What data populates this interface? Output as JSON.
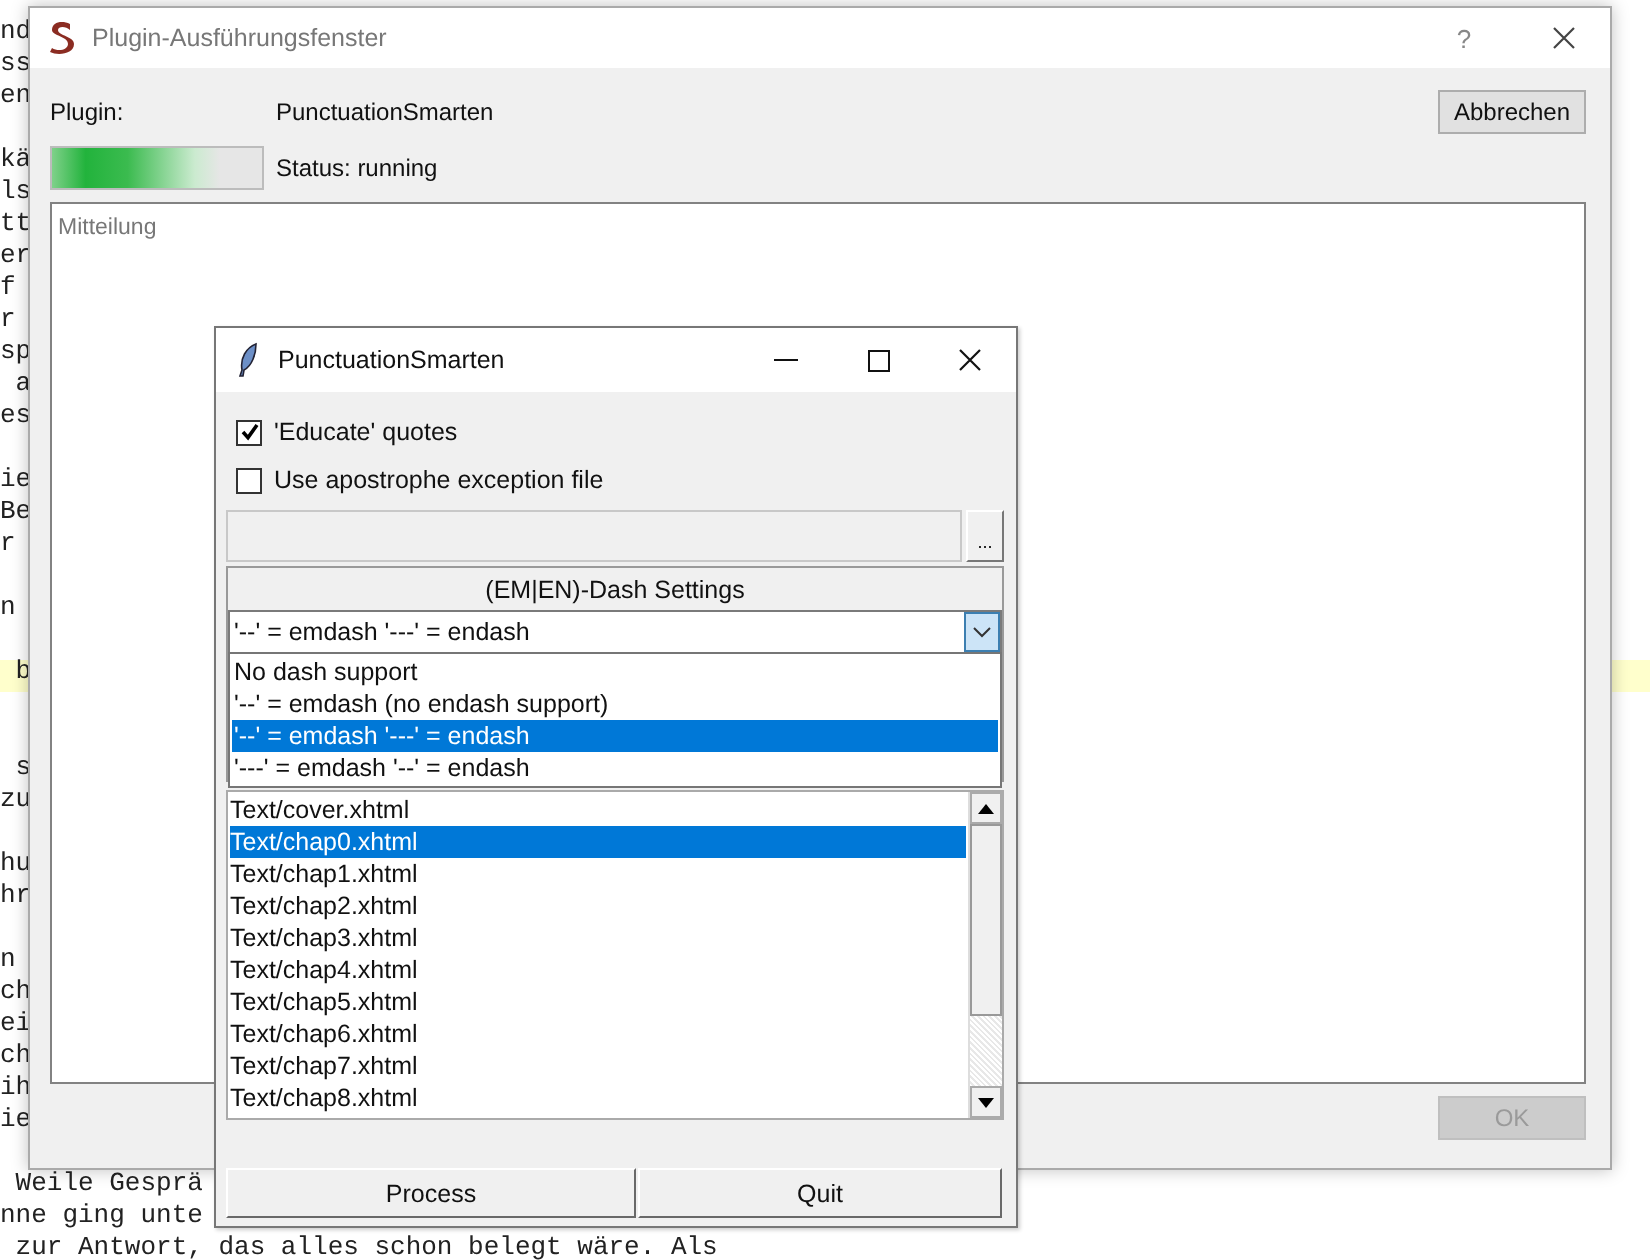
{
  "editor": {
    "blocks": [
      {
        "lines": [
          "nd",
          "ss",
          "en"
        ],
        "highlighted": false
      },
      {
        "lines": [
          "kä",
          "ls",
          "tt",
          "er",
          "f",
          "r",
          "sp",
          " a",
          "es"
        ],
        "highlighted": false
      },
      {
        "lines": [
          "ie",
          "Be",
          "r"
        ],
        "highlighted": false
      },
      {
        "lines": [
          "n"
        ],
        "highlighted": false
      },
      {
        "lines": [
          " b"
        ],
        "highlighted": true
      },
      {
        "lines": [
          " s",
          "zu"
        ],
        "highlighted": false
      },
      {
        "lines": [
          "hu",
          "hr"
        ],
        "highlighted": false
      },
      {
        "lines": [
          "n",
          "ch",
          "ei",
          "ch",
          "ih",
          "ie"
        ],
        "highlighted": false
      },
      {
        "lines": [
          " Weile Gesprä",
          "nne ging unte",
          " zur Antwort, das alles schon belegt wäre. Als"
        ],
        "highlighted": false
      }
    ]
  },
  "main_window": {
    "title": "Plugin-Ausführungsfenster",
    "help": "?",
    "plugin_label": "Plugin:",
    "plugin_name": "PunctuationSmarten",
    "cancel_button": "Abbrechen",
    "progress": {
      "level": 0.8
    },
    "status": "Status: running",
    "message_placeholder": "Mitteilung",
    "ok_button": {
      "label": "OK",
      "disabled": true
    }
  },
  "dialog": {
    "title": "PunctuationSmarten",
    "checkboxes": [
      {
        "label": "'Educate' quotes",
        "checked": true
      },
      {
        "label": "Use apostrophe exception file",
        "checked": false
      }
    ],
    "browse_button": "...",
    "dash_group": {
      "title": "(EM|EN)-Dash Settings",
      "value": "'--' = emdash '---' = endash",
      "options": [
        {
          "label": "No dash support",
          "selected": false
        },
        {
          "label": "'--' = emdash (no endash support)",
          "selected": false
        },
        {
          "label": "'--' = emdash '---' = endash",
          "selected": true
        },
        {
          "label": "'---' = emdash '--' = endash",
          "selected": false
        }
      ]
    },
    "files": [
      {
        "label": "Text/cover.xhtml",
        "selected": false
      },
      {
        "label": "Text/chap0.xhtml",
        "selected": true
      },
      {
        "label": "Text/chap1.xhtml",
        "selected": false
      },
      {
        "label": "Text/chap2.xhtml",
        "selected": false
      },
      {
        "label": "Text/chap3.xhtml",
        "selected": false
      },
      {
        "label": "Text/chap4.xhtml",
        "selected": false
      },
      {
        "label": "Text/chap5.xhtml",
        "selected": false
      },
      {
        "label": "Text/chap6.xhtml",
        "selected": false
      },
      {
        "label": "Text/chap7.xhtml",
        "selected": false
      },
      {
        "label": "Text/chap8.xhtml",
        "selected": false
      }
    ],
    "buttons": [
      "Process",
      "Quit"
    ]
  }
}
